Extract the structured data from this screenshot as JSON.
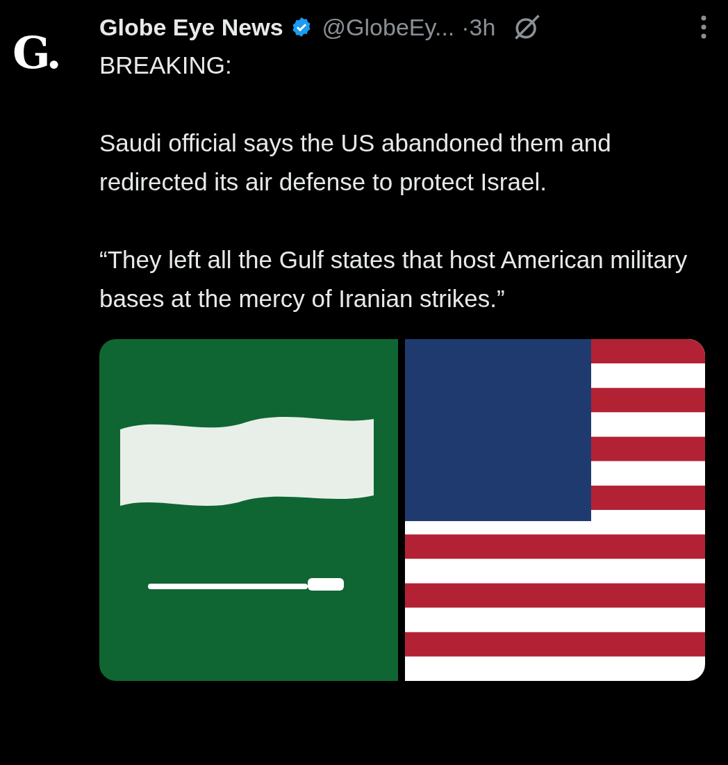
{
  "post": {
    "avatar": "G.",
    "author": "Globe Eye News",
    "verified": true,
    "handle": "@GlobeEy...",
    "time": "·3h",
    "paragraphs": [
      "BREAKING:",
      "Saudi official says the US abandoned them and redirected its air defense to protect Israel.",
      "“They left all the Gulf states that host American military bases at the mercy of Iranian strikes.”"
    ]
  }
}
